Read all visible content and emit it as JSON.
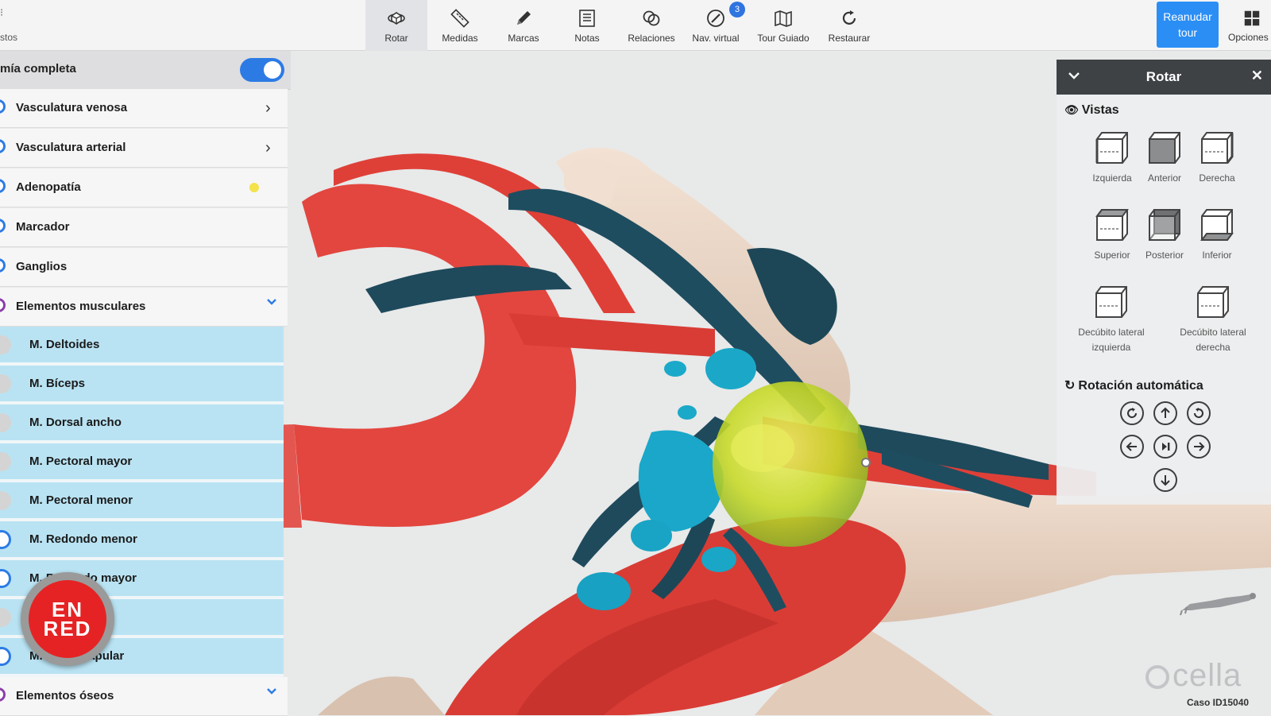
{
  "toolbar": {
    "left_label": "stos",
    "tools": [
      {
        "label": "Rotar",
        "icon": "rotate-3d-icon",
        "active": true
      },
      {
        "label": "Medidas",
        "icon": "ruler-icon"
      },
      {
        "label": "Marcas",
        "icon": "pencil-icon"
      },
      {
        "label": "Notas",
        "icon": "notes-icon"
      },
      {
        "label": "Relaciones",
        "icon": "relations-icon"
      },
      {
        "label": "Nav. virtual",
        "icon": "compass-icon",
        "badge": "3"
      },
      {
        "label": "Tour Guiado",
        "icon": "map-icon"
      },
      {
        "label": "Restaurar",
        "icon": "refresh-icon"
      }
    ],
    "resume_button": "Reanudar\ntour",
    "options_label": "Opciones"
  },
  "layer_panel": {
    "header_label": "mía completa",
    "header_toggle_on": true,
    "rows": [
      {
        "label": "Vasculatura venosa"
      },
      {
        "label": "Vasculatura arterial"
      },
      {
        "label": "Adenopatía"
      },
      {
        "label": "Marcador"
      },
      {
        "label": "Ganglios"
      },
      {
        "label": "Elementos musculares"
      }
    ],
    "muscle_items": [
      {
        "label": "M. Deltoides",
        "visible": false
      },
      {
        "label": "M. Bíceps",
        "visible": false
      },
      {
        "label": "M. Dorsal ancho",
        "visible": false
      },
      {
        "label": "M. Pectoral mayor",
        "visible": false
      },
      {
        "label": "M. Pectoral menor",
        "visible": false
      },
      {
        "label": "M. Redondo menor",
        "visible": true
      },
      {
        "label": "M. Redondo mayor",
        "visible": true
      },
      {
        "label": "",
        "visible": false
      },
      {
        "label": "M. Subescapular",
        "visible": true
      }
    ],
    "bone_row": "Elementos óseos"
  },
  "logo_badge": {
    "line1": "EN",
    "line2": "RED"
  },
  "rotate_panel": {
    "title": "Rotar",
    "views_title": "Vistas",
    "views": [
      {
        "label": "Izquierda"
      },
      {
        "label": "Anterior"
      },
      {
        "label": "Derecha"
      },
      {
        "label": "Superior"
      },
      {
        "label": "Posterior"
      },
      {
        "label": "Inferior"
      },
      {
        "label": "Decúbito lateral izquierda"
      },
      {
        "label": "Decúbito lateral derecha"
      }
    ],
    "auto_rotation_title": "Rotación automática"
  },
  "brand": "cella",
  "case_id": "Caso ID15040",
  "colors": {
    "accent": "#2a8ef5",
    "artery": "#e2463f",
    "vein": "#1e4a5c",
    "node": "#1aa7c9",
    "tumor": "#d6e12a",
    "bone": "#ecd6c6",
    "muscle_row": "#b9e3f3"
  }
}
